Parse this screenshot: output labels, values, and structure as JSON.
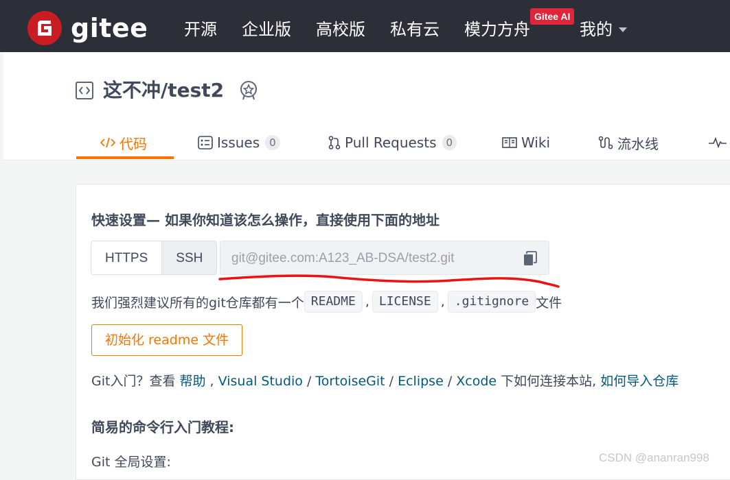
{
  "nav": {
    "logo_text": "gitee",
    "items": [
      "开源",
      "企业版",
      "高校版",
      "私有云",
      "模力方舟",
      "我的"
    ],
    "badge": "Gitee AI"
  },
  "repo": {
    "title": "这不冲/test2"
  },
  "tabs": [
    {
      "label": "代码",
      "count": null
    },
    {
      "label": "Issues",
      "count": "0"
    },
    {
      "label": "Pull Requests",
      "count": "0"
    },
    {
      "label": "Wiki",
      "count": null
    },
    {
      "label": "流水线",
      "count": null
    }
  ],
  "quick_setup": {
    "title": "快速设置— 如果你知道该怎么操作，直接使用下面的地址",
    "protocols": [
      "HTTPS",
      "SSH"
    ],
    "selected_protocol": "SSH",
    "url": "git@gitee.com:A123_AB-DSA/test2.git",
    "suggest_prefix": "我们强烈建议所有的git仓库都有一个",
    "files": [
      "README",
      "LICENSE",
      ".gitignore"
    ],
    "suggest_suffix": "文件",
    "init_button": "初始化 readme 文件",
    "help": {
      "prefix": "Git入门？查看 ",
      "help_link": "帮助",
      "sep1": " , ",
      "links": [
        "Visual Studio",
        "TortoiseGit",
        "Eclipse",
        "Xcode"
      ],
      "middle": " 下如何连接本站, ",
      "import_link": "如何导入仓库"
    }
  },
  "tutorial": {
    "title": "简易的命令行入门教程:",
    "global_settings": "Git 全局设置:"
  },
  "watermark": "CSDN @ananran998",
  "colors": {
    "nav_bg": "#2c2f38",
    "accent": "#fe7300",
    "brand_red": "#c71d23",
    "link": "#005980"
  }
}
